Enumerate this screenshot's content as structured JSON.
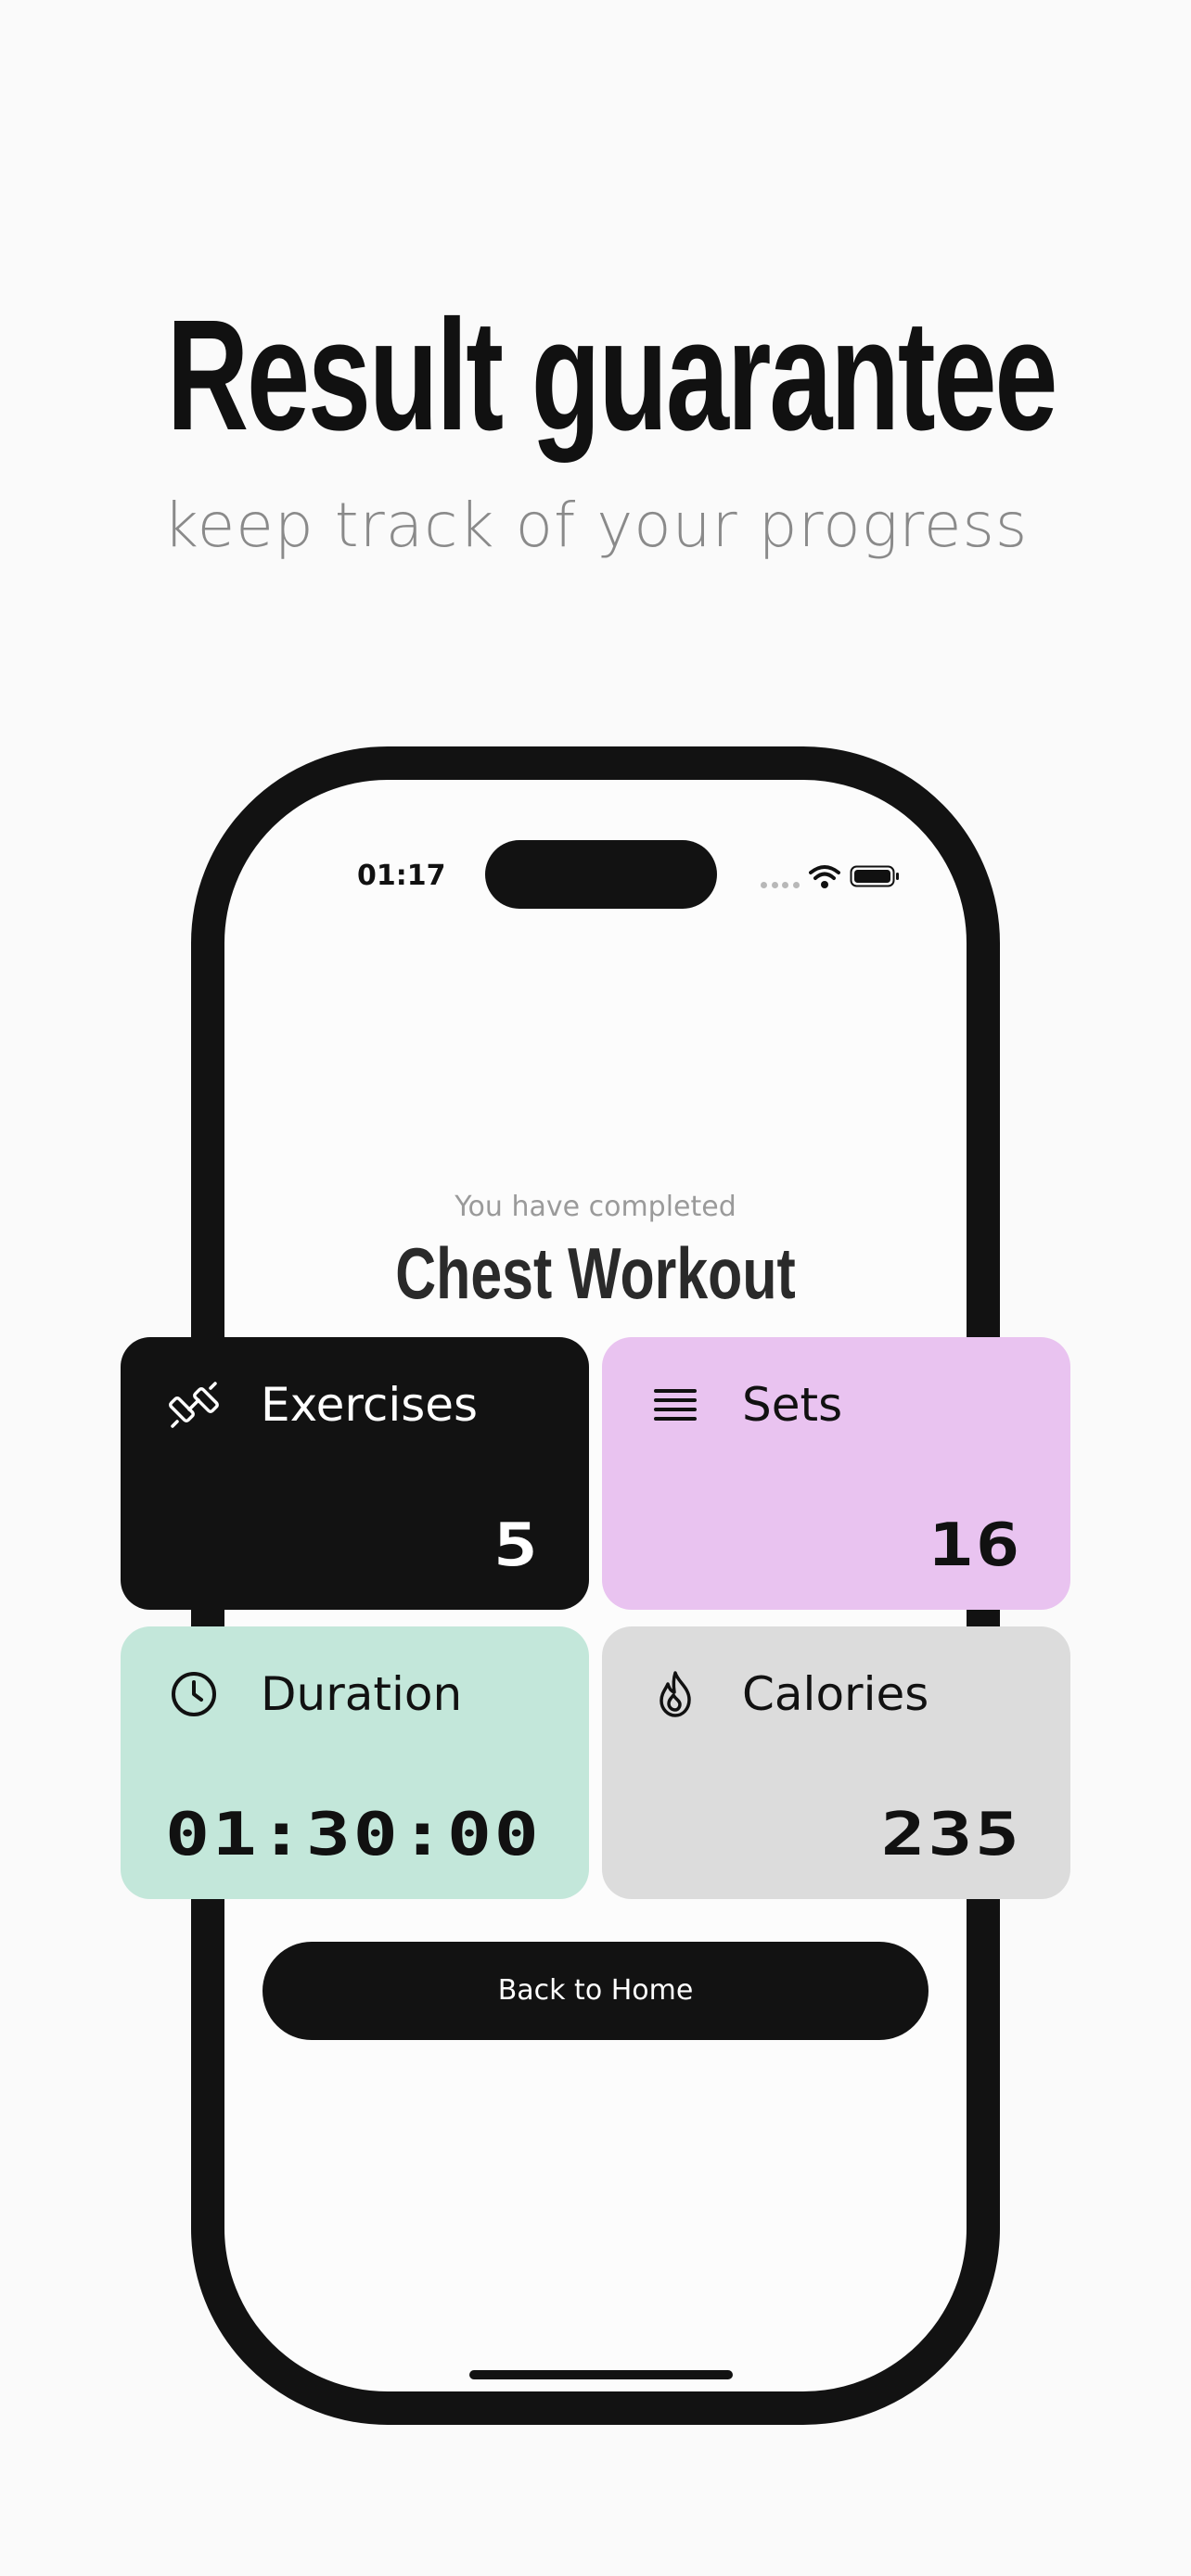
{
  "header": {
    "title": "Result guarantee",
    "subtitle": "keep track of your progress"
  },
  "status_bar": {
    "time": "01:17",
    "icons": [
      "signal-dots",
      "wifi-icon",
      "battery-icon"
    ]
  },
  "summary": {
    "completed_label": "You have completed",
    "workout_name": "Chest Workout"
  },
  "stats": {
    "exercises": {
      "label": "Exercises",
      "value": "5",
      "icon": "dumbbell-icon",
      "color": "#121212"
    },
    "sets": {
      "label": "Sets",
      "value": "16",
      "icon": "list-icon",
      "color": "#e9c3f0"
    },
    "duration": {
      "label": "Duration",
      "value": "01:30:00",
      "icon": "clock-icon",
      "color": "#c3e7da"
    },
    "calories": {
      "label": "Calories",
      "value": "235",
      "icon": "flame-icon",
      "color": "#dcdcdc"
    }
  },
  "actions": {
    "back_home_label": "Back to Home"
  }
}
